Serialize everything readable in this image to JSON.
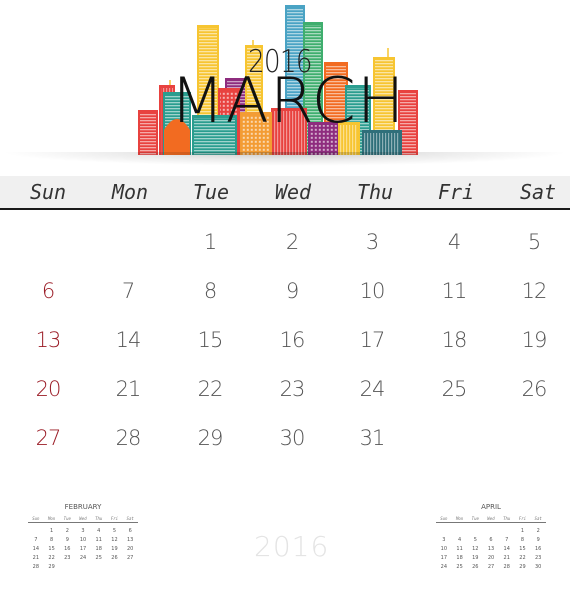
{
  "header": {
    "year": "2016",
    "month": "MARCH"
  },
  "weekdays": [
    "Sun",
    "Mon",
    "Tue",
    "Wed",
    "Thu",
    "Fri",
    "Sat"
  ],
  "weeks": [
    [
      "",
      "",
      "1",
      "2",
      "3",
      "4",
      "5"
    ],
    [
      "6",
      "7",
      "8",
      "9",
      "10",
      "11",
      "12"
    ],
    [
      "13",
      "14",
      "15",
      "16",
      "17",
      "18",
      "19"
    ],
    [
      "20",
      "21",
      "22",
      "23",
      "24",
      "25",
      "26"
    ],
    [
      "27",
      "28",
      "29",
      "30",
      "31",
      "",
      ""
    ]
  ],
  "colors": {
    "sunday": "#9b1c26",
    "day": "#555555",
    "header_bar": "#f0f0f0",
    "watermark": "#e4e4e4"
  },
  "watermark_year": "2016",
  "mini_calendars": [
    {
      "title": "FEBRUARY",
      "weekdays": [
        "Sun",
        "Mon",
        "Tue",
        "Wed",
        "Thu",
        "Fri",
        "Sat"
      ],
      "weeks": [
        [
          "",
          "1",
          "2",
          "3",
          "4",
          "5",
          "6"
        ],
        [
          "7",
          "8",
          "9",
          "10",
          "11",
          "12",
          "13"
        ],
        [
          "14",
          "15",
          "16",
          "17",
          "18",
          "19",
          "20"
        ],
        [
          "21",
          "22",
          "23",
          "24",
          "25",
          "26",
          "27"
        ],
        [
          "28",
          "29",
          "",
          "",
          "",
          "",
          ""
        ]
      ]
    },
    {
      "title": "APRIL",
      "weekdays": [
        "Sun",
        "Mon",
        "Tue",
        "Wed",
        "Thu",
        "Fri",
        "Sat"
      ],
      "weeks": [
        [
          "",
          "",
          "",
          "",
          "",
          "1",
          "2"
        ],
        [
          "3",
          "4",
          "5",
          "6",
          "7",
          "8",
          "9"
        ],
        [
          "10",
          "11",
          "12",
          "13",
          "14",
          "15",
          "16"
        ],
        [
          "17",
          "18",
          "19",
          "20",
          "21",
          "22",
          "23"
        ],
        [
          "24",
          "25",
          "26",
          "27",
          "28",
          "29",
          "30"
        ]
      ]
    }
  ],
  "skyline": {
    "building_colors": [
      "#e8423f",
      "#2a9d8f",
      "#f7c531",
      "#f26b21",
      "#8e2c7e",
      "#4aa3c4",
      "#3fae6e",
      "#e04b45",
      "#2f6f7a",
      "#f39c34"
    ]
  }
}
